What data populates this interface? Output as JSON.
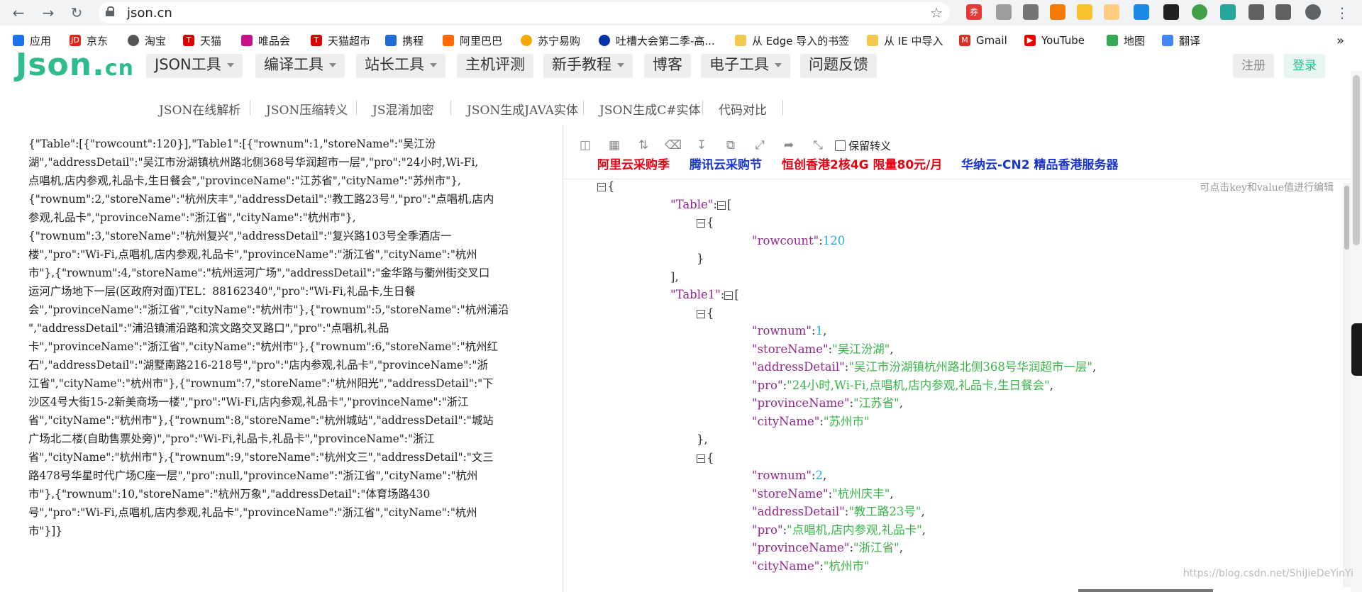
{
  "browser": {
    "url": "json.cn",
    "ext_coupon_label": "券",
    "bookmarks": [
      {
        "label": "应用",
        "color": "#1a73e8"
      },
      {
        "label": "京东",
        "color": "#e1251b"
      },
      {
        "label": "淘宝",
        "color": "#555"
      },
      {
        "label": "天猫",
        "color": "#d00"
      },
      {
        "label": "唯品会",
        "color": "#c7118c"
      },
      {
        "label": "天猫超市",
        "color": "#d00"
      },
      {
        "label": "携程",
        "color": "#1c6cd8"
      },
      {
        "label": "阿里巴巴",
        "color": "#ff6a00"
      },
      {
        "label": "苏宁易购",
        "color": "#f7a800"
      },
      {
        "label": "吐槽大会第二季-高...",
        "color": "#0033aa"
      },
      {
        "label": "从 Edge 导入的书签",
        "color": "#f2c94c"
      },
      {
        "label": "从 IE 中导入",
        "color": "#f2c94c"
      },
      {
        "label": "Gmail",
        "color": "#d93025"
      },
      {
        "label": "YouTube",
        "color": "#e00"
      },
      {
        "label": "地图",
        "color": "#34a853"
      },
      {
        "label": "翻译",
        "color": "#4285f4"
      }
    ]
  },
  "site": {
    "logo_main": "Json",
    "logo_dot": ".",
    "logo_cn": "cn",
    "menus": [
      "JSON工具",
      "编译工具",
      "站长工具",
      "主机评测",
      "新手教程",
      "博客",
      "电子工具",
      "问题反馈"
    ],
    "register": "注册",
    "login": "登录",
    "subnav": [
      "JSON在线解析",
      "JSON压缩转义",
      "JS混淆加密",
      "JSON生成JAVA实体",
      "JSON生成C#实体",
      "代码对比"
    ]
  },
  "editor": {
    "raw_lines": [
      "{\"Table\":[{\"rowcount\":120}],\"Table1\":[{\"rownum\":1,\"storeName\":\"吴江汾",
      "湖\",\"addressDetail\":\"吴江市汾湖镇杭州路北侧368号华润超市一层\",\"pro\":\"24小时,Wi-Fi,",
      "点唱机,店内参观,礼品卡,生日餐会\",\"provinceName\":\"江苏省\",\"cityName\":\"苏州市\"},",
      "{\"rownum\":2,\"storeName\":\"杭州庆丰\",\"addressDetail\":\"教工路23号\",\"pro\":\"点唱机,店内",
      "参观,礼品卡\",\"provinceName\":\"浙江省\",\"cityName\":\"杭州市\"},",
      "{\"rownum\":3,\"storeName\":\"杭州复兴\",\"addressDetail\":\"复兴路103号全季酒店一",
      "楼\",\"pro\":\"Wi-Fi,点唱机,店内参观,礼品卡\",\"provinceName\":\"浙江省\",\"cityName\":\"杭州",
      "市\"},{\"rownum\":4,\"storeName\":\"杭州运河广场\",\"addressDetail\":\"金华路与衢州街交叉口",
      "运河广场地下一层(区政府对面)TEL：88162340\",\"pro\":\"Wi-Fi,礼品卡,生日餐",
      "会\",\"provinceName\":\"浙江省\",\"cityName\":\"杭州市\"},{\"rownum\":5,\"storeName\":\"杭州浦沿",
      "\",\"addressDetail\":\"浦沿镇浦沿路和滨文路交叉路口\",\"pro\":\"点唱机,礼品",
      "卡\",\"provinceName\":\"浙江省\",\"cityName\":\"杭州市\"},{\"rownum\":6,\"storeName\":\"杭州红",
      "石\",\"addressDetail\":\"湖墅南路216-218号\",\"pro\":\"店内参观,礼品卡\",\"provinceName\":\"浙",
      "江省\",\"cityName\":\"杭州市\"},{\"rownum\":7,\"storeName\":\"杭州阳光\",\"addressDetail\":\"下",
      "沙区4号大街15-2新美商场一楼\",\"pro\":\"Wi-Fi,店内参观,礼品卡\",\"provinceName\":\"浙江",
      "省\",\"cityName\":\"杭州市\"},{\"rownum\":8,\"storeName\":\"杭州城站\",\"addressDetail\":\"城站",
      "广场北二楼(自助售票处旁)\",\"pro\":\"Wi-Fi,礼品卡,礼品卡\",\"provinceName\":\"浙江",
      "省\",\"cityName\":\"杭州市\"},{\"rownum\":9,\"storeName\":\"杭州文三\",\"addressDetail\":\"文三",
      "路478号华星时代广场C座一层\",\"pro\":null,\"provinceName\":\"浙江省\",\"cityName\":\"杭州",
      "市\"},{\"rownum\":10,\"storeName\":\"杭州万象\",\"addressDetail\":\"体育场路430",
      "号\",\"pro\":\"Wi-Fi,点唱机,店内参观,礼品卡\",\"provinceName\":\"浙江省\",\"cityName\":\"杭州",
      "市\"}]}"
    ],
    "keep_escape_label": "保留转义",
    "hint": "可点击key和value值进行编辑",
    "ads": [
      {
        "label": "阿里云采购季",
        "color": "#e50012"
      },
      {
        "label": "腾讯云采购节",
        "color": "#1a35c9"
      },
      {
        "label": "恒创香港2核4G 限量80元/月",
        "color": "#e50012"
      },
      {
        "label": "华纳云-CN2 精品香港服务器",
        "color": "#1a35c9"
      }
    ],
    "tree": [
      {
        "indent": 0,
        "toggle": true,
        "parts": [
          [
            "pun",
            "{"
          ]
        ]
      },
      {
        "indent": 1,
        "toggle": false,
        "parts": [
          [
            "key",
            "\"Table\""
          ],
          [
            "pun",
            ":"
          ],
          [
            "tog",
            ""
          ],
          [
            "pun",
            "["
          ]
        ]
      },
      {
        "indent": 2,
        "toggle": true,
        "parts": [
          [
            "pun",
            "{"
          ]
        ]
      },
      {
        "indent": 3,
        "toggle": false,
        "parts": [
          [
            "key",
            "\"rowcount\""
          ],
          [
            "pun",
            ":"
          ],
          [
            "num",
            "120"
          ]
        ]
      },
      {
        "indent": 2,
        "toggle": false,
        "parts": [
          [
            "pun",
            "}"
          ]
        ]
      },
      {
        "indent": 1,
        "toggle": false,
        "parts": [
          [
            "pun",
            "],"
          ]
        ]
      },
      {
        "indent": 1,
        "toggle": false,
        "parts": [
          [
            "key",
            "\"Table1\""
          ],
          [
            "pun",
            ":"
          ],
          [
            "tog",
            ""
          ],
          [
            "pun",
            "["
          ]
        ]
      },
      {
        "indent": 2,
        "toggle": true,
        "parts": [
          [
            "pun",
            "{"
          ]
        ]
      },
      {
        "indent": 3,
        "toggle": false,
        "parts": [
          [
            "key",
            "\"rownum\""
          ],
          [
            "pun",
            ":"
          ],
          [
            "num",
            "1"
          ],
          [
            "pun",
            ","
          ]
        ]
      },
      {
        "indent": 3,
        "toggle": false,
        "parts": [
          [
            "key",
            "\"storeName\""
          ],
          [
            "pun",
            ":"
          ],
          [
            "str",
            "\"吴江汾湖\""
          ],
          [
            "pun",
            ","
          ]
        ]
      },
      {
        "indent": 3,
        "toggle": false,
        "parts": [
          [
            "key",
            "\"addressDetail\""
          ],
          [
            "pun",
            ":"
          ],
          [
            "str",
            "\"吴江市汾湖镇杭州路北侧368号华润超市一层\""
          ],
          [
            "pun",
            ","
          ]
        ]
      },
      {
        "indent": 3,
        "toggle": false,
        "parts": [
          [
            "key",
            "\"pro\""
          ],
          [
            "pun",
            ":"
          ],
          [
            "str",
            "\"24小时,Wi-Fi,点唱机,店内参观,礼品卡,生日餐会\""
          ],
          [
            "pun",
            ","
          ]
        ]
      },
      {
        "indent": 3,
        "toggle": false,
        "parts": [
          [
            "key",
            "\"provinceName\""
          ],
          [
            "pun",
            ":"
          ],
          [
            "str",
            "\"江苏省\""
          ],
          [
            "pun",
            ","
          ]
        ]
      },
      {
        "indent": 3,
        "toggle": false,
        "parts": [
          [
            "key",
            "\"cityName\""
          ],
          [
            "pun",
            ":"
          ],
          [
            "str",
            "\"苏州市\""
          ]
        ]
      },
      {
        "indent": 2,
        "toggle": false,
        "parts": [
          [
            "pun",
            "},"
          ]
        ]
      },
      {
        "indent": 2,
        "toggle": true,
        "parts": [
          [
            "pun",
            "{"
          ]
        ]
      },
      {
        "indent": 3,
        "toggle": false,
        "parts": [
          [
            "key",
            "\"rownum\""
          ],
          [
            "pun",
            ":"
          ],
          [
            "num",
            "2"
          ],
          [
            "pun",
            ","
          ]
        ]
      },
      {
        "indent": 3,
        "toggle": false,
        "parts": [
          [
            "key",
            "\"storeName\""
          ],
          [
            "pun",
            ":"
          ],
          [
            "str",
            "\"杭州庆丰\""
          ],
          [
            "pun",
            ","
          ]
        ]
      },
      {
        "indent": 3,
        "toggle": false,
        "parts": [
          [
            "key",
            "\"addressDetail\""
          ],
          [
            "pun",
            ":"
          ],
          [
            "str",
            "\"教工路23号\""
          ],
          [
            "pun",
            ","
          ]
        ]
      },
      {
        "indent": 3,
        "toggle": false,
        "parts": [
          [
            "key",
            "\"pro\""
          ],
          [
            "pun",
            ":"
          ],
          [
            "str",
            "\"点唱机,店内参观,礼品卡\""
          ],
          [
            "pun",
            ","
          ]
        ]
      },
      {
        "indent": 3,
        "toggle": false,
        "parts": [
          [
            "key",
            "\"provinceName\""
          ],
          [
            "pun",
            ":"
          ],
          [
            "str",
            "\"浙江省\""
          ],
          [
            "pun",
            ","
          ]
        ]
      },
      {
        "indent": 3,
        "toggle": false,
        "parts": [
          [
            "key",
            "\"cityName\""
          ],
          [
            "pun",
            ":"
          ],
          [
            "str",
            "\"杭州市\""
          ]
        ]
      }
    ]
  },
  "watermark": "https://blog.csdn.net/ShiJieDeYinYi"
}
